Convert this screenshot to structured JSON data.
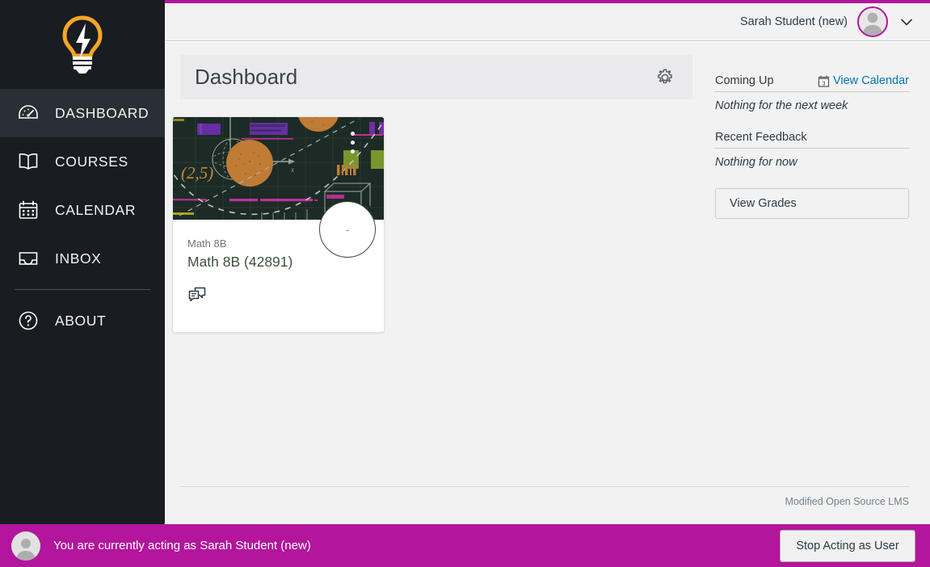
{
  "theme": {
    "brand_magenta": "#b3159c",
    "sidebar_bg": "#191c21",
    "content_bg": "#f2f2f3",
    "link_blue": "#0374b5",
    "course_green": "#3c513c",
    "logo_orange": "#f5a623"
  },
  "sidebar": {
    "logo_name": "lightbulb-logo",
    "items": [
      {
        "label": "DASHBOARD",
        "icon": "dashboard-gauge-icon",
        "active": true
      },
      {
        "label": "COURSES",
        "icon": "book-icon",
        "active": false
      },
      {
        "label": "CALENDAR",
        "icon": "calendar-icon",
        "active": false
      },
      {
        "label": "INBOX",
        "icon": "inbox-icon",
        "active": false
      },
      {
        "label": "ABOUT",
        "icon": "question-circle-icon",
        "active": false
      }
    ]
  },
  "header": {
    "user_name": "Sarah Student (new)",
    "avatar_name": "user-avatar",
    "chevron_name": "chevron-down-icon"
  },
  "page": {
    "title": "Dashboard",
    "settings_icon": "gear-icon"
  },
  "course_card": {
    "term": "Math 8B",
    "name": "Math 8B (42891)",
    "grade_value": "-",
    "kebab_label": "course-card-options",
    "icons": [
      {
        "name": "announcements-icon",
        "title": "Announcements"
      }
    ],
    "image": {
      "alt": "math-coordinate-graph-image",
      "bg": "#1d2b26",
      "point_label": "(2,5)",
      "axis_label": "x"
    }
  },
  "right_rail": {
    "coming_up_title": "Coming Up",
    "view_calendar_label": "View Calendar",
    "calendar_icon_day": "3",
    "coming_up_empty": "Nothing for the next week",
    "recent_feedback_title": "Recent Feedback",
    "recent_feedback_empty": "Nothing for now",
    "view_grades_label": "View Grades"
  },
  "footer": {
    "text": "Modified Open Source LMS"
  },
  "masquerade": {
    "message": "You are currently acting as Sarah Student (new)",
    "stop_button_label": "Stop Acting as User",
    "avatar_name": "masquerade-avatar"
  }
}
